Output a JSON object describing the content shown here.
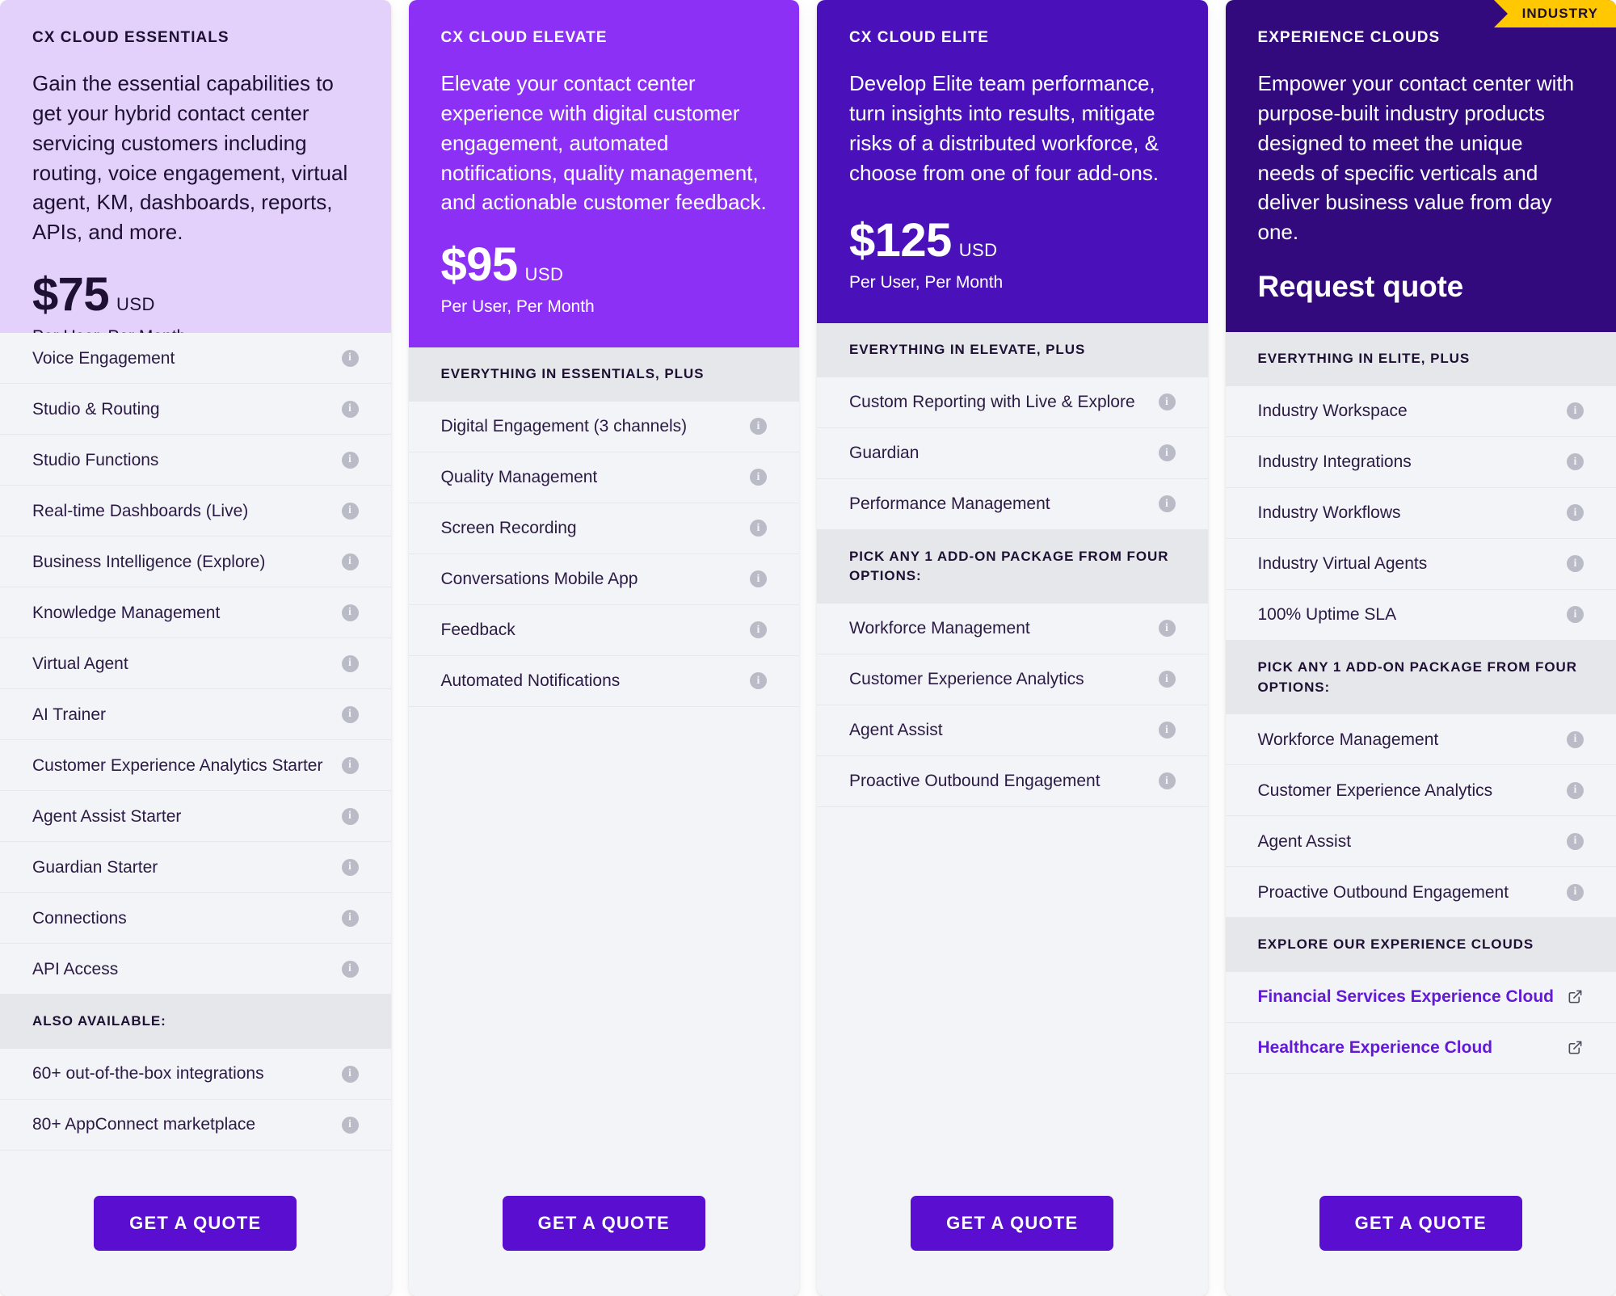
{
  "icons": {
    "info": "i",
    "info_name": "info-icon",
    "external_link_name": "external-link-icon"
  },
  "colors": {
    "essentials_bg": "#e4d1fb",
    "elevate_bg": "#8c30f5",
    "elite_bg": "#4a11ba",
    "industry_bg": "#330a7d",
    "ribbon_bg": "#ffc800",
    "cta_bg": "#5a0ed0",
    "link_text": "#6419d6",
    "section_head_bg": "#e6e7eb",
    "list_bg": "#f3f4f7"
  },
  "cta_label": "GET A QUOTE",
  "plans": [
    {
      "eyebrow": "CX CLOUD ESSENTIALS",
      "description": "Gain the essential capabilities to get your hybrid contact center servicing customers including routing, voice engagement, virtual agent, KM, dashboards, reports, APIs, and more.",
      "price_amount": "$75",
      "price_currency": "USD",
      "price_period": "Per User, Per Month",
      "cta_label": "GET A QUOTE",
      "badge": null,
      "sections": [
        {
          "heading": null,
          "items": [
            {
              "label": "Voice Engagement",
              "icon": "info"
            },
            {
              "label": "Studio & Routing",
              "icon": "info"
            },
            {
              "label": "Studio Functions",
              "icon": "info"
            },
            {
              "label": "Real-time Dashboards (Live)",
              "icon": "info"
            },
            {
              "label": "Business Intelligence (Explore)",
              "icon": "info"
            },
            {
              "label": "Knowledge Management",
              "icon": "info"
            },
            {
              "label": "Virtual Agent",
              "icon": "info"
            },
            {
              "label": "AI Trainer",
              "icon": "info"
            },
            {
              "label": "Customer Experience Analytics Starter",
              "icon": "info"
            },
            {
              "label": "Agent Assist Starter",
              "icon": "info"
            },
            {
              "label": "Guardian Starter",
              "icon": "info"
            },
            {
              "label": "Connections",
              "icon": "info"
            },
            {
              "label": "API Access",
              "icon": "info"
            }
          ]
        },
        {
          "heading": "ALSO AVAILABLE:",
          "items": [
            {
              "label": "60+ out-of-the-box integrations",
              "icon": "info"
            },
            {
              "label": "80+ AppConnect marketplace",
              "icon": "info"
            }
          ]
        }
      ]
    },
    {
      "eyebrow": "CX CLOUD ELEVATE",
      "description": "Elevate your contact center experience with digital customer engagement, automated notifications, quality management, and actionable customer feedback.",
      "price_amount": "$95",
      "price_currency": "USD",
      "price_period": "Per User, Per Month",
      "cta_label": "GET A QUOTE",
      "badge": null,
      "sections": [
        {
          "heading": "EVERYTHING IN ESSENTIALS, PLUS",
          "items": [
            {
              "label": "Digital Engagement (3 channels)",
              "icon": "info"
            },
            {
              "label": "Quality Management",
              "icon": "info"
            },
            {
              "label": "Screen Recording",
              "icon": "info"
            },
            {
              "label": "Conversations Mobile App",
              "icon": "info"
            },
            {
              "label": "Feedback",
              "icon": "info"
            },
            {
              "label": "Automated Notifications",
              "icon": "info"
            }
          ]
        }
      ]
    },
    {
      "eyebrow": "CX CLOUD ELITE",
      "description": "Develop Elite team performance, turn insights into results, mitigate risks of a distributed workforce, & choose from one of four add-ons.",
      "price_amount": "$125",
      "price_currency": "USD",
      "price_period": "Per User, Per Month",
      "cta_label": "GET A QUOTE",
      "badge": null,
      "sections": [
        {
          "heading": "EVERYTHING IN ELEVATE, PLUS",
          "items": [
            {
              "label": "Custom Reporting with Live & Explore",
              "icon": "info"
            },
            {
              "label": "Guardian",
              "icon": "info"
            },
            {
              "label": "Performance Management",
              "icon": "info"
            }
          ]
        },
        {
          "heading": "PICK ANY 1 ADD-ON PACKAGE FROM FOUR OPTIONS:",
          "items": [
            {
              "label": "Workforce Management",
              "icon": "info"
            },
            {
              "label": "Customer Experience Analytics",
              "icon": "info"
            },
            {
              "label": "Agent Assist",
              "icon": "info"
            },
            {
              "label": "Proactive Outbound Engagement",
              "icon": "info"
            }
          ]
        }
      ]
    },
    {
      "eyebrow": "EXPERIENCE CLOUDS",
      "description": "Empower your contact center with purpose-built industry products designed to meet the unique needs of specific verticals and deliver business value from day one.",
      "price_amount": null,
      "price_currency": null,
      "price_period": null,
      "quote_label": "Request quote",
      "cta_label": "GET A QUOTE",
      "badge": "INDUSTRY",
      "sections": [
        {
          "heading": "EVERYTHING IN ELITE, PLUS",
          "items": [
            {
              "label": "Industry Workspace",
              "icon": "info"
            },
            {
              "label": "Industry Integrations",
              "icon": "info"
            },
            {
              "label": "Industry Workflows",
              "icon": "info"
            },
            {
              "label": "Industry Virtual Agents",
              "icon": "info"
            },
            {
              "label": "100% Uptime SLA",
              "icon": "info"
            }
          ]
        },
        {
          "heading": "PICK ANY 1 ADD-ON PACKAGE FROM FOUR OPTIONS:",
          "items": [
            {
              "label": "Workforce Management",
              "icon": "info"
            },
            {
              "label": "Customer Experience Analytics",
              "icon": "info"
            },
            {
              "label": "Agent Assist",
              "icon": "info"
            },
            {
              "label": "Proactive Outbound Engagement",
              "icon": "info"
            }
          ]
        },
        {
          "heading": "EXPLORE OUR EXPERIENCE CLOUDS",
          "items": [
            {
              "label": "Financial Services Experience Cloud",
              "icon": "external",
              "link": true
            },
            {
              "label": "Healthcare Experience Cloud",
              "icon": "external",
              "link": true
            }
          ]
        }
      ]
    }
  ]
}
